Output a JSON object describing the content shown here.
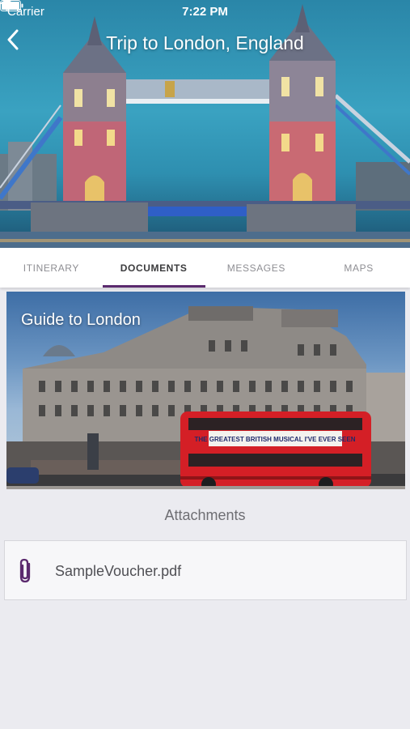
{
  "status_bar": {
    "carrier": "Carrier",
    "time": "7:22 PM",
    "icons": [
      "wifi-icon",
      "battery-icon"
    ]
  },
  "nav": {
    "back_icon": "chevron-left-icon",
    "title": "Trip to London, England"
  },
  "tabs": [
    {
      "label": "ITINERARY",
      "active": false
    },
    {
      "label": "DOCUMENTS",
      "active": true
    },
    {
      "label": "MESSAGES",
      "active": false
    },
    {
      "label": "MAPS",
      "active": false
    }
  ],
  "guide": {
    "title": "Guide to London",
    "banner_text": "THE GREATEST BRITISH MUSICAL I'VE EVER SEEN"
  },
  "attachments": {
    "heading": "Attachments",
    "items": [
      {
        "name": "SampleVoucher.pdf",
        "icon": "paperclip-icon"
      }
    ]
  },
  "colors": {
    "accent": "#5b2a6e",
    "background": "#ebebf0",
    "tab_inactive": "#8e8e93",
    "tab_active": "#3a3a3c"
  }
}
